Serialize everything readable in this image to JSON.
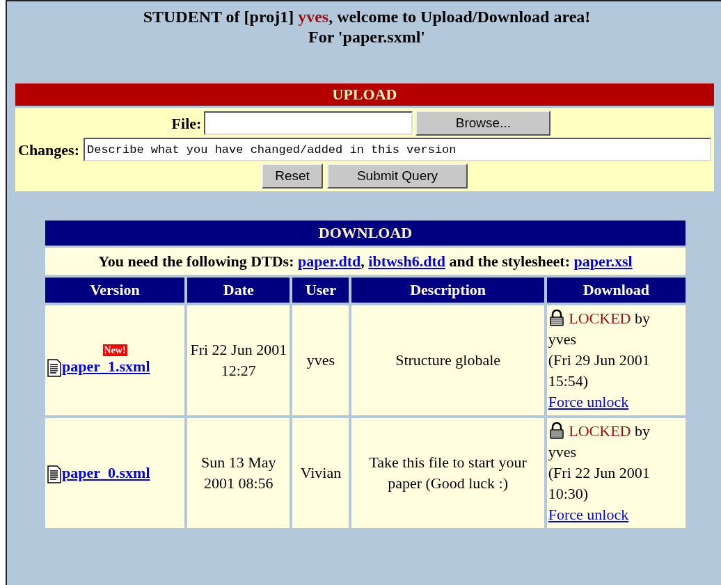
{
  "heading": {
    "prefix": "STUDENT of [proj1]",
    "user": "yves",
    "suffix": ", welcome to Upload/Download area!",
    "file_line": "For 'paper.sxml'"
  },
  "upload": {
    "title": "UPLOAD",
    "file_label": "File:",
    "browse_button": "Browse...",
    "changes_label": "Changes:",
    "changes_value": "Describe what you have changed/added in this version",
    "buttons": [
      "Reset",
      "Submit Query"
    ]
  },
  "download": {
    "title": "DOWNLOAD",
    "note_before": "You need the following DTDs:",
    "links": [
      "paper.dtd",
      "ibtwsh6.dtd"
    ],
    "link_separator": ",",
    "note_middle": "and the stylesheet:",
    "stylesheet_link": "paper.xsl",
    "columns": [
      "Version",
      "Date",
      "User",
      "Description",
      "Download"
    ],
    "rows": [
      {
        "file": "paper_1.sxml",
        "new": true,
        "new_label": "New!",
        "date": "Fri 22 Jun 2001 12:27",
        "user": "yves",
        "description": "Structure globale",
        "locked": true,
        "status": "LOCKED",
        "by_text": "by",
        "lock_user": "yves",
        "lock_time": "(Fri 29 Jun 2001 15:54)",
        "action": "Force unlock"
      },
      {
        "file": "paper_0.sxml",
        "new": false,
        "date": "Sun 13 May 2001 08:56",
        "user": "Vivian",
        "description": "Take this file to start your paper (Good luck :)",
        "locked": true,
        "status": "LOCKED",
        "by_text": "by",
        "lock_user": "yves",
        "lock_time": "(Fri 22 Jun 2001 10:30)",
        "action": "Force unlock"
      }
    ]
  }
}
